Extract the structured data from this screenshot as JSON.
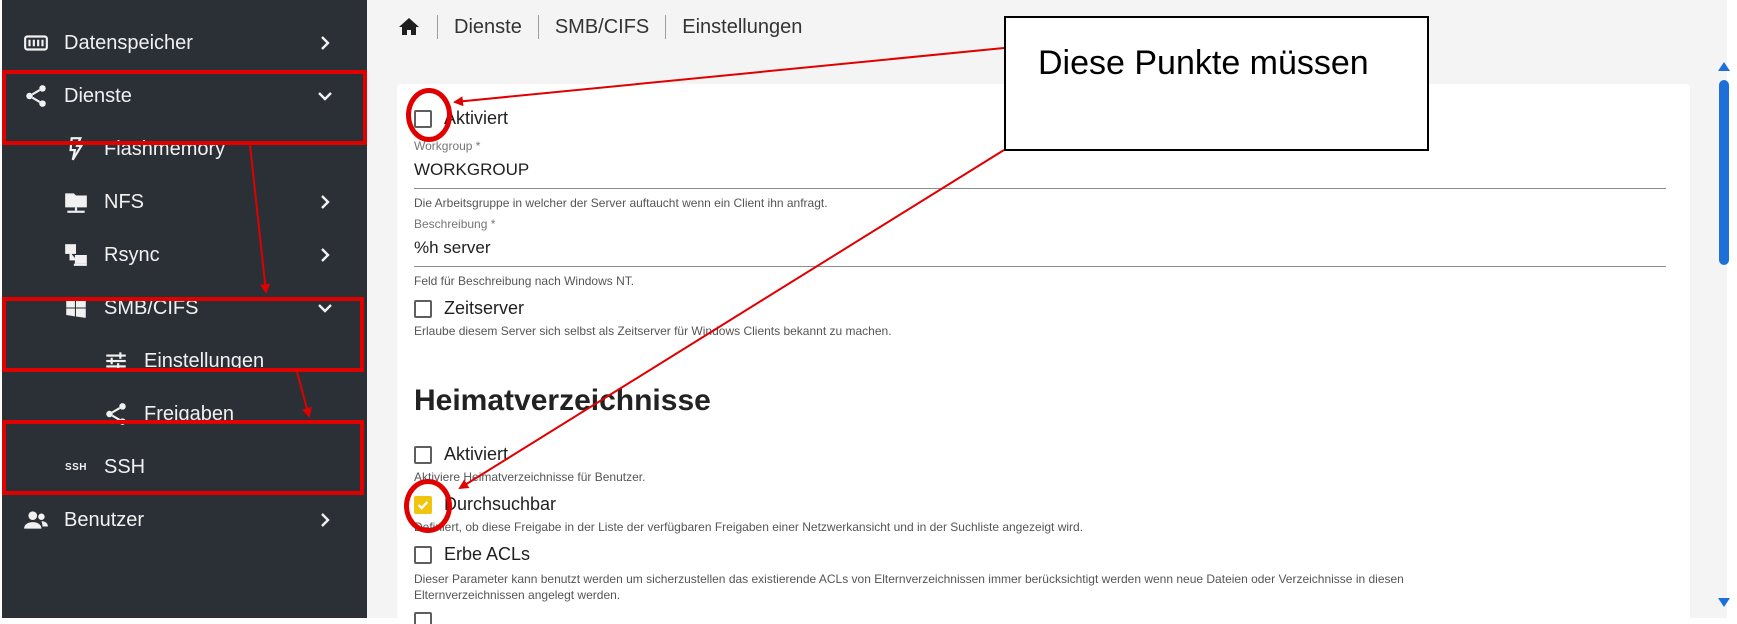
{
  "sidebar": {
    "items": [
      {
        "label": "Datenspeicher",
        "icon": "storage-icon",
        "expand": "chevron-right"
      },
      {
        "label": "Dienste",
        "icon": "share-icon",
        "expand": "chevron-down"
      },
      {
        "label": "Flashmemory",
        "icon": "flash-icon",
        "expand": ""
      },
      {
        "label": "NFS",
        "icon": "network-folder-icon",
        "expand": "chevron-right"
      },
      {
        "label": "Rsync",
        "icon": "rsync-icon",
        "expand": "chevron-right"
      },
      {
        "label": "SMB/CIFS",
        "icon": "windows-icon",
        "expand": "chevron-down"
      },
      {
        "label": "Einstellungen",
        "icon": "settings-sliders-icon",
        "expand": ""
      },
      {
        "label": "Freigaben",
        "icon": "share-icon",
        "expand": ""
      },
      {
        "label": "SSH",
        "icon": "ssh-icon",
        "expand": ""
      },
      {
        "label": "Benutzer",
        "icon": "users-icon",
        "expand": "chevron-right"
      }
    ],
    "ssh_icon_text": "SSH"
  },
  "breadcrumb": [
    "Dienste",
    "SMB/CIFS",
    "Einstellungen"
  ],
  "form": {
    "enabled_label": "Aktiviert",
    "workgroup_label": "Workgroup *",
    "workgroup_value": "WORKGROUP",
    "workgroup_hint": "Die Arbeitsgruppe in welcher der Server auftaucht wenn ein Client ihn anfragt.",
    "description_label": "Beschreibung *",
    "description_value": "%h server",
    "description_hint": "Feld für Beschreibung nach Windows NT.",
    "timeserver_label": "Zeitserver",
    "timeserver_hint": "Erlaube diesem Server sich selbst als Zeitserver für Windows Clients bekannt zu machen.",
    "home_heading": "Heimatverzeichnisse",
    "home_enabled_label": "Aktiviert",
    "home_enabled_hint": "Aktiviere Heimatverzeichnisse für Benutzer.",
    "browseable_label": "Durchsuchbar",
    "browseable_hint": "Definiert, ob diese Freigabe in der Liste der verfügbaren Freigaben einer Netzwerkansicht und in der Suchliste angezeigt wird.",
    "inherit_acls_label": "Erbe ACLs",
    "inherit_acls_hint_1": "Dieser Parameter kann benutzt werden um sicherzustellen das existierende ACLs von Elternverzeichnissen immer berücksichtigt werden wenn neue Dateien oder Verzeichnisse in diesen",
    "inherit_acls_hint_2": "Elternverzeichnissen angelegt werden."
  },
  "checkbox_states": {
    "enabled": false,
    "timeserver": false,
    "home_enabled": false,
    "browseable": true,
    "inherit_acls": false
  },
  "annotation": {
    "callout_text": "Diese Punkte müssen",
    "color": "#e00000"
  },
  "colors": {
    "sidebar_bg": "#2b3036",
    "accent": "#1e6fd9",
    "checkbox_checked": "#f1c40f"
  }
}
